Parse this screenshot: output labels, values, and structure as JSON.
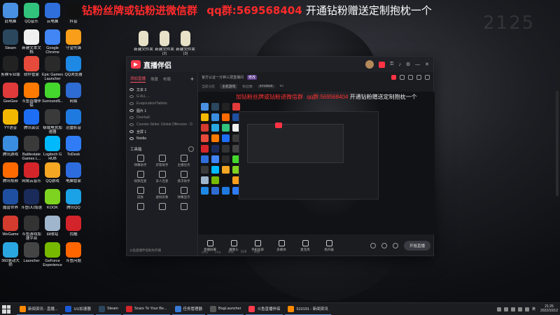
{
  "banner": {
    "part1": "加钻粉丝牌或钻粉进微信群",
    "part2": "qq群:569568404",
    "part3": "开通钻粉赠送定制抱枕一个"
  },
  "wallpaper_number": "2125",
  "desktop_icons": [
    {
      "label": "此电脑",
      "icon": "monitor-icon",
      "color": "#4a90e2"
    },
    {
      "label": "Steam",
      "icon": "steam-icon",
      "color": "#2a475e"
    },
    {
      "label": "剪映专业版",
      "icon": "capcut-icon",
      "color": "#222222"
    },
    {
      "label": "GeeGee",
      "icon": "geegee-icon",
      "color": "#e03a3a"
    },
    {
      "label": "YY语音",
      "icon": "yy-icon",
      "color": "#f2b700"
    },
    {
      "label": "腾讯游戏",
      "icon": "tencent-game-icon",
      "color": "#3b8de0"
    },
    {
      "label": "腾讯视频",
      "icon": "tencent-video-icon",
      "color": "#ff6a00"
    },
    {
      "label": "魔兽世界",
      "icon": "wow-icon",
      "color": "#1f4fa0"
    },
    {
      "label": "WeGame",
      "icon": "wegame-icon",
      "color": "#d33b2f"
    },
    {
      "label": "360驱动大师",
      "icon": "driver-icon",
      "color": "#2aa7e0"
    },
    {
      "label": "QQ音乐",
      "icon": "qqmusic-icon",
      "color": "#31c27c"
    },
    {
      "label": "新建文本文档",
      "icon": "text-file-icon",
      "color": "#f0f0f0"
    },
    {
      "label": "软件管家",
      "icon": "store-icon",
      "color": "#e64a3b"
    },
    {
      "label": "斗鱼直播伴侣",
      "icon": "douyu-icon",
      "color": "#ff7a00"
    },
    {
      "label": "腾讯会议",
      "icon": "meeting-icon",
      "color": "#1d6ef5"
    },
    {
      "label": "Battlestate Games L...",
      "icon": "bsg-icon",
      "color": "#3a3a3a"
    },
    {
      "label": "网易云音乐",
      "icon": "netease-music-icon",
      "color": "#d5252b"
    },
    {
      "label": "斗鱼UU加速",
      "icon": "uu-icon",
      "color": "#1a2b5a"
    },
    {
      "label": "斗鱼游戏加速平台",
      "icon": "accelerator-icon",
      "color": "#333333"
    },
    {
      "label": "Launcher",
      "icon": "launcher-icon",
      "color": "#444444"
    },
    {
      "label": "云电脑",
      "icon": "cloud-pc-icon",
      "color": "#2f6fdc"
    },
    {
      "label": "Google Chrome",
      "icon": "chrome-icon",
      "color": "#4285f4"
    },
    {
      "label": "Epic Games Launcher",
      "icon": "epic-icon",
      "color": "#2a2a2a"
    },
    {
      "label": "SurroundS...",
      "icon": "razer-icon",
      "color": "#44d62c"
    },
    {
      "label": "极致电竞加速器",
      "icon": "esports-icon",
      "color": "#3a3a3a"
    },
    {
      "label": "Logitech G HUB",
      "icon": "logitech-icon",
      "color": "#00b8fc"
    },
    {
      "label": "QQ游戏",
      "icon": "qqgame-icon",
      "color": "#f5a623"
    },
    {
      "label": "KOOK",
      "icon": "kook-icon",
      "color": "#7ed321"
    },
    {
      "label": "回收站",
      "icon": "recycle-bin-icon",
      "color": "#9fb6cc"
    },
    {
      "label": "GeForce Experience",
      "icon": "nvidia-icon",
      "color": "#76b900"
    },
    {
      "label": "抖音",
      "icon": "douyin-icon",
      "color": "#111111"
    },
    {
      "label": "守望先锋",
      "icon": "overwatch-icon",
      "color": "#f99e1a"
    },
    {
      "label": "QQ浏览器",
      "icon": "qqbrowser-icon",
      "color": "#1e88e5"
    },
    {
      "label": "网易",
      "icon": "netease-icon",
      "color": "#2e6bd3"
    },
    {
      "label": "迅雷影音",
      "icon": "xunlei-icon",
      "color": "#1f7ae0"
    },
    {
      "label": "ToDesk",
      "icon": "todesk-icon",
      "color": "#2f7cf6"
    },
    {
      "label": "电脑管家",
      "icon": "pc-manager-icon",
      "color": "#2d6cdf"
    },
    {
      "label": "腾讯QQ",
      "icon": "qq-icon",
      "color": "#1aa1e6"
    },
    {
      "label": "优酷",
      "icon": "youku-icon",
      "color": "#d3242b"
    },
    {
      "label": "斗鱼问题",
      "icon": "question-icon",
      "color": "#ff6600"
    }
  ],
  "folder_icons": [
    {
      "label": "新建文件夹"
    },
    {
      "label": "新建文件夹(2)"
    },
    {
      "label": "新建文件夹(3)"
    }
  ],
  "app": {
    "title": "直播伴侣",
    "sidebar_tabs": [
      "添加直播",
      "场景",
      "布局"
    ],
    "active_tab": "添加直播",
    "scenes": [
      {
        "label": "文本 3",
        "visible": true
      },
      {
        "label": "G ALL ...",
        "visible": false
      },
      {
        "label": "Evaporation/Tablets",
        "visible": false
      },
      {
        "label": "图片 1",
        "visible": true
      },
      {
        "label": "Overlaid",
        "visible": false
      },
      {
        "label": "Counter-Strike: Global Offensive - Direct3D 9",
        "visible": false
      },
      {
        "label": "全屏 1",
        "visible": true
      },
      {
        "label": "Nvidia",
        "visible": true
      }
    ],
    "tools_header": "工具箱",
    "tools": [
      {
        "label": "弹幕助手",
        "icon": "danmaku-icon"
      },
      {
        "label": "房管助手",
        "icon": "admin-icon"
      },
      {
        "label": "主播任务",
        "icon": "task-icon"
      },
      {
        "label": "视频连麦",
        "icon": "video-link-icon"
      },
      {
        "label": "多人连麦",
        "icon": "multi-link-icon"
      },
      {
        "label": "悬浮助手",
        "icon": "float-icon"
      },
      {
        "label": "皮肤",
        "icon": "skin-icon"
      },
      {
        "label": "虚拟形象",
        "icon": "avatar-icon"
      },
      {
        "label": "弹幕显示",
        "icon": "danmaku-display-icon"
      },
      {
        "label": "",
        "icon": "more-icon"
      },
      {
        "label": "",
        "icon": "hot-icon"
      },
      {
        "label": "",
        "icon": "box-icon"
      }
    ],
    "sidebar_footer": "斗鱼直播伴侣助你开播",
    "room": {
      "title": "官方认证一分钟三把直播间",
      "tag": "修改",
      "info": [
        "当前分区",
        "主机游戏",
        "粉丝数",
        "5743525",
        "93"
      ]
    },
    "preview_banner": {
      "part1": "加钻粉丝牌或钻粉进微信群",
      "part2": "qq群:569568404",
      "part3": "开通钻粉赠送定制抱枕一个"
    },
    "controls": [
      {
        "label": "直播屏幕",
        "icon": "screen-icon"
      },
      {
        "label": "摄像头",
        "icon": "camera-icon"
      },
      {
        "label": "手机投屏",
        "icon": "phone-icon"
      },
      {
        "label": "多媒体",
        "icon": "media-icon"
      },
      {
        "label": "麦克风",
        "icon": "mic-icon"
      },
      {
        "label": "扬声器",
        "icon": "speaker-icon"
      }
    ],
    "go_live": "开始直播",
    "status": [
      "CPU",
      "FPS",
      "丢帧",
      "码率",
      "网速"
    ]
  },
  "taskbar": {
    "items": [
      {
        "label": "新闻资讯 - 直播...",
        "color": "#ff8a00"
      },
      {
        "label": "UU加速器",
        "color": "#1a5ad6"
      },
      {
        "label": "Steam",
        "color": "#2a475e"
      },
      {
        "label": "Scars To Your Be...",
        "color": "#d5252b"
      },
      {
        "label": "任务管理器",
        "color": "#3a7bd5"
      },
      {
        "label": "BsgLauncher",
        "color": "#555555"
      },
      {
        "label": "斗鱼直播伴侣",
        "color": "#ff3b4e"
      },
      {
        "label": "510191 - 新闻资讯",
        "color": "#ff8a00"
      }
    ],
    "tray_lang": "英",
    "time": "21:25",
    "date": "2022/10/12"
  }
}
